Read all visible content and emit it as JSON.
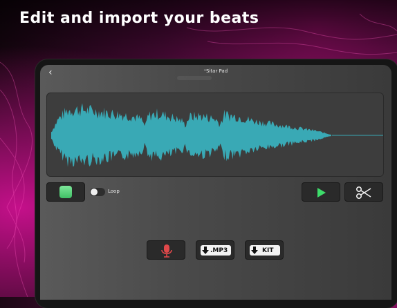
{
  "headline": "Edit and import your beats",
  "screen": {
    "title": "ˣSitar Pad"
  },
  "controls": {
    "loop_label": "Loop",
    "mp3_label": ".MP3",
    "kit_label": "KIT"
  },
  "icons": {
    "back": "chevron-left-icon",
    "play": "play-icon",
    "cut": "scissors-icon",
    "record": "microphone-icon",
    "download": "download-arrow-icon"
  },
  "colors": {
    "waveform": "#39a9b5",
    "play": "#3ddc6a",
    "record": "#e0484a",
    "pad": "#5ed37f"
  }
}
